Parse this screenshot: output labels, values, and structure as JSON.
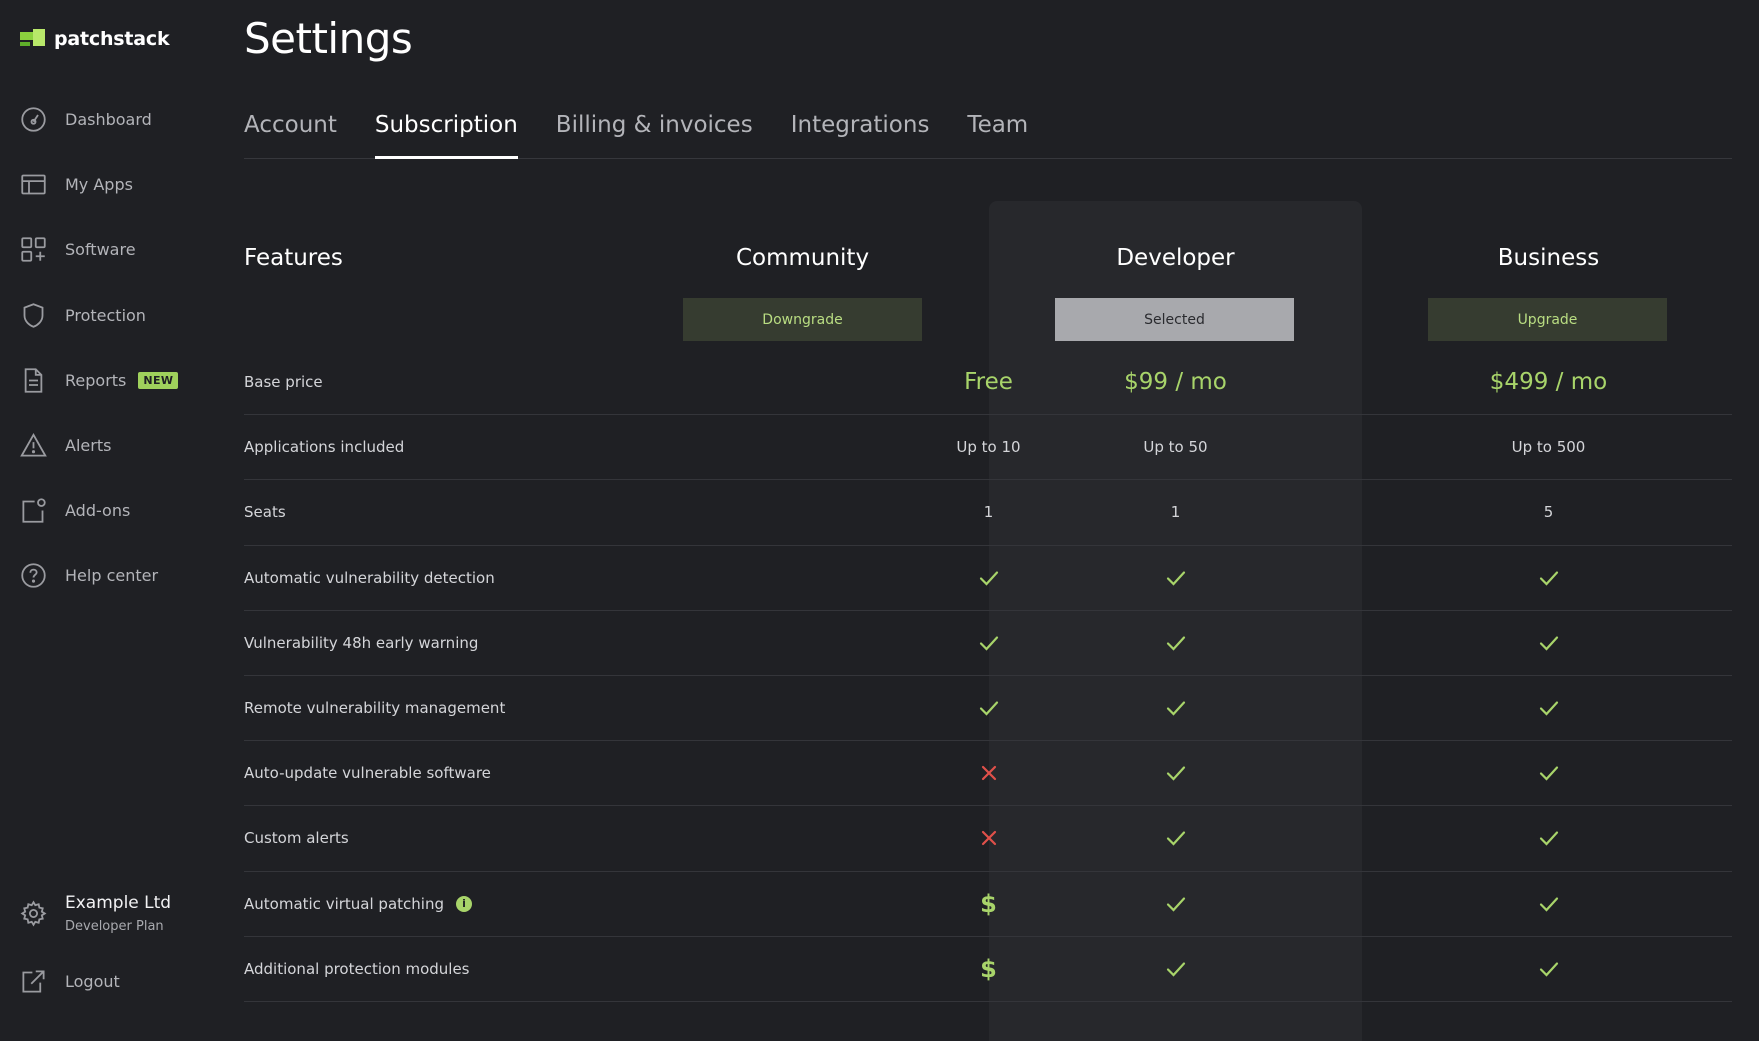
{
  "app": {
    "name": "patchstack"
  },
  "sidebar": {
    "items": [
      {
        "id": "dashboard",
        "label": "Dashboard",
        "icon": "gauge-icon"
      },
      {
        "id": "my-apps",
        "label": "My Apps",
        "icon": "layout-icon"
      },
      {
        "id": "software",
        "label": "Software",
        "icon": "grid-plus-icon"
      },
      {
        "id": "protection",
        "label": "Protection",
        "icon": "shield-icon"
      },
      {
        "id": "reports",
        "label": "Reports",
        "icon": "document-icon",
        "badge": "NEW"
      },
      {
        "id": "alerts",
        "label": "Alerts",
        "icon": "warning-icon"
      },
      {
        "id": "add-ons",
        "label": "Add-ons",
        "icon": "addon-icon"
      },
      {
        "id": "help-center",
        "label": "Help center",
        "icon": "help-icon"
      }
    ],
    "organization": {
      "name": "Example Ltd",
      "plan": "Developer Plan"
    },
    "logout_label": "Logout"
  },
  "page": {
    "title": "Settings"
  },
  "tabs": [
    {
      "label": "Account",
      "active": false
    },
    {
      "label": "Subscription",
      "active": true
    },
    {
      "label": "Billing & invoices",
      "active": false
    },
    {
      "label": "Integrations",
      "active": false
    },
    {
      "label": "Team",
      "active": false
    }
  ],
  "pricing": {
    "features_label": "Features",
    "plans": [
      {
        "name": "Community",
        "button": "Downgrade",
        "selected": false
      },
      {
        "name": "Developer",
        "button": "Selected",
        "selected": true
      },
      {
        "name": "Business",
        "button": "Upgrade",
        "selected": false
      }
    ],
    "rows": [
      {
        "feature": "Base price",
        "type": "price",
        "values": [
          "Free",
          "$99 / mo",
          "$499 / mo"
        ]
      },
      {
        "feature": "Applications included",
        "type": "text",
        "values": [
          "Up to 10",
          "Up to 50",
          "Up to 500"
        ]
      },
      {
        "feature": "Seats",
        "type": "text",
        "values": [
          "1",
          "1",
          "5"
        ]
      },
      {
        "feature": "Automatic vulnerability detection",
        "type": "status",
        "values": [
          "check",
          "check",
          "check"
        ]
      },
      {
        "feature": "Vulnerability 48h early warning",
        "type": "status",
        "values": [
          "check",
          "check",
          "check"
        ]
      },
      {
        "feature": "Remote vulnerability management",
        "type": "status",
        "values": [
          "check",
          "check",
          "check"
        ]
      },
      {
        "feature": "Auto-update vulnerable software",
        "type": "status",
        "values": [
          "cross",
          "check",
          "check"
        ]
      },
      {
        "feature": "Custom alerts",
        "type": "status",
        "values": [
          "cross",
          "check",
          "check"
        ]
      },
      {
        "feature": "Automatic virtual patching",
        "type": "status",
        "info": true,
        "values": [
          "dollar",
          "check",
          "check"
        ]
      },
      {
        "feature": "Additional protection modules",
        "type": "status",
        "values": [
          "dollar",
          "check",
          "check"
        ]
      }
    ],
    "symbols": {
      "dollar": "$"
    }
  },
  "colors": {
    "background": "#1f2024",
    "highlight_column": "#27282c",
    "accent_green": "#a8d46a",
    "cross_red": "#e0504a",
    "icon_gray": "#9a9ba0"
  }
}
